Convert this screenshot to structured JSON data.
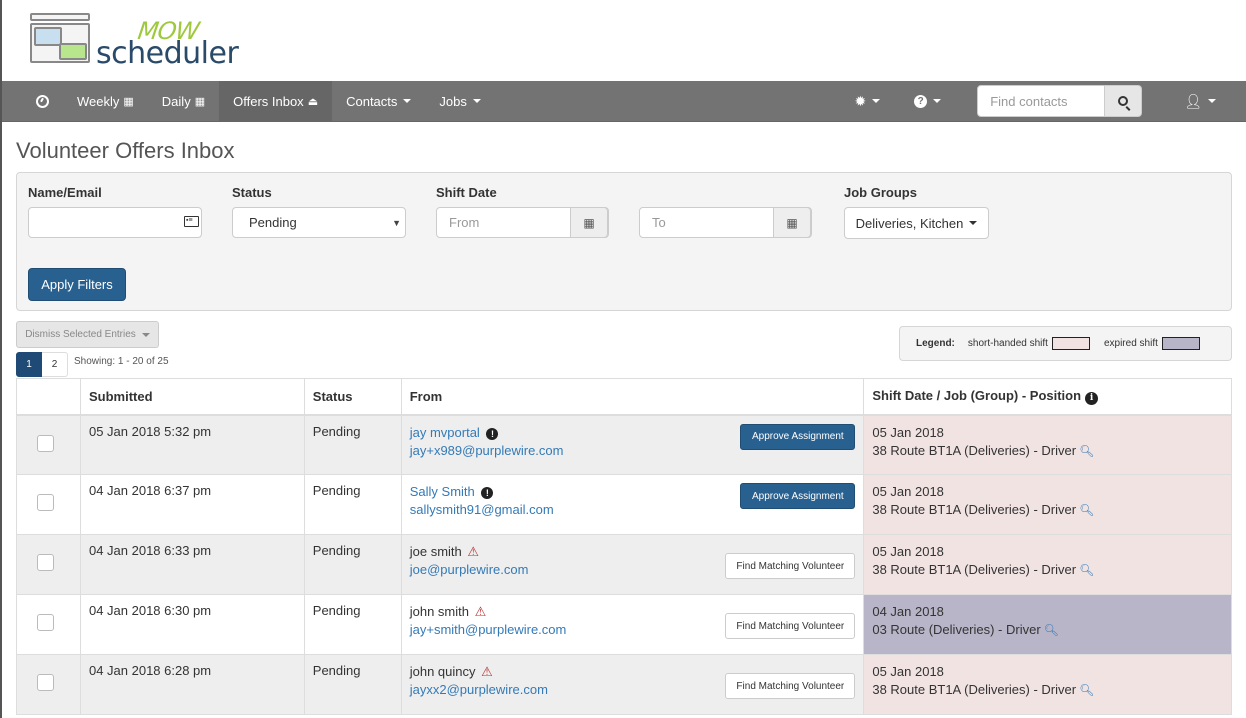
{
  "app": {
    "logo_top": "MOW",
    "logo_bottom": "scheduler"
  },
  "navbar": {
    "items": [
      {
        "label": "",
        "icon": "dashboard-icon"
      },
      {
        "label": "Weekly",
        "icon": "calendar-icon"
      },
      {
        "label": "Daily",
        "icon": "calendar-icon"
      },
      {
        "label": "Offers Inbox",
        "icon": "inbox-icon",
        "active": true
      },
      {
        "label": "Contacts",
        "icon": "caret-down-icon"
      },
      {
        "label": "Jobs",
        "icon": "caret-down-icon"
      }
    ],
    "right": {
      "settings_icon": "gear-icon",
      "help_icon": "question-icon",
      "search_placeholder": "Find contacts",
      "search_value": "",
      "search_button_icon": "search-icon",
      "user_icon": "user-icon"
    }
  },
  "page": {
    "title": "Volunteer Offers Inbox"
  },
  "filters": {
    "name_email": {
      "label": "Name/Email",
      "value": "",
      "icon": "contact-card-icon"
    },
    "status": {
      "label": "Status",
      "value": "Pending"
    },
    "shift_date": {
      "label": "Shift Date",
      "from_placeholder": "From",
      "to_placeholder": "To",
      "from_value": "",
      "to_value": ""
    },
    "job_groups": {
      "label": "Job Groups",
      "value": "Deliveries, Kitchen"
    },
    "apply_label": "Apply Filters"
  },
  "actions": {
    "dismiss_label": "Dismiss Selected Entries",
    "pages": [
      "1",
      "2"
    ],
    "current_page": "1",
    "showing": "Showing: 1 - 20 of 25"
  },
  "legend": {
    "label": "Legend:",
    "items": [
      {
        "label": "short-handed shift",
        "color": "#f2e3e3"
      },
      {
        "label": "expired shift",
        "color": "#b9b5c9"
      }
    ]
  },
  "table": {
    "headers": [
      "",
      "Submitted",
      "Status",
      "From",
      "Shift Date / Job (Group) - Position"
    ],
    "rows": [
      {
        "submitted": "05 Jan 2018 5:32 pm",
        "status": "Pending",
        "name": "jay mvportal",
        "name_is_link": true,
        "flag": "exclamation",
        "email": "jay+x989@purplewire.com",
        "action": "Approve Assignment",
        "shift_date": "05 Jan 2018",
        "shift_job": "38 Route BT1A (Deliveries) - Driver",
        "shift_state": "short"
      },
      {
        "submitted": "04 Jan 2018 6:37 pm",
        "status": "Pending",
        "name": "Sally Smith",
        "name_is_link": true,
        "flag": "exclamation",
        "email": "sallysmith91@gmail.com",
        "action": "Approve Assignment",
        "shift_date": "05 Jan 2018",
        "shift_job": "38 Route BT1A (Deliveries) - Driver",
        "shift_state": "short"
      },
      {
        "submitted": "04 Jan 2018 6:33 pm",
        "status": "Pending",
        "name": "joe smith",
        "name_is_link": false,
        "flag": "warning",
        "email": "joe@purplewire.com",
        "action": "Find Matching Volunteer",
        "shift_date": "05 Jan 2018",
        "shift_job": "38 Route BT1A (Deliveries) - Driver",
        "shift_state": "short"
      },
      {
        "submitted": "04 Jan 2018 6:30 pm",
        "status": "Pending",
        "name": "john smith",
        "name_is_link": false,
        "flag": "warning",
        "email": "jay+smith@purplewire.com",
        "action": "Find Matching Volunteer",
        "shift_date": "04 Jan 2018",
        "shift_job": "03 Route (Deliveries) - Driver",
        "shift_state": "expired"
      },
      {
        "submitted": "04 Jan 2018 6:28 pm",
        "status": "Pending",
        "name": "john quincy",
        "name_is_link": false,
        "flag": "warning",
        "email": "jayxx2@purplewire.com",
        "action": "Find Matching Volunteer",
        "shift_date": "05 Jan 2018",
        "shift_job": "38 Route BT1A (Deliveries) - Driver",
        "shift_state": "short"
      }
    ]
  }
}
